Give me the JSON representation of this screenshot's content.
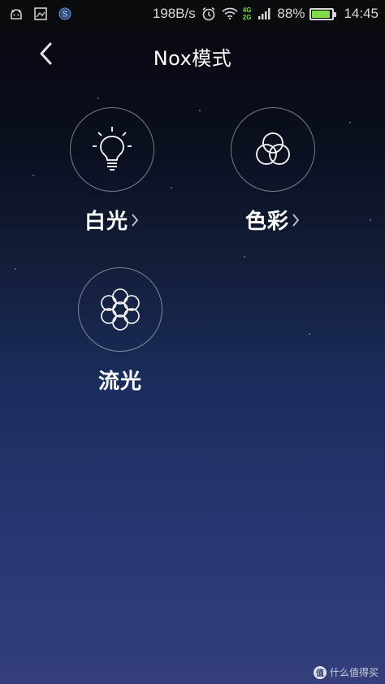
{
  "status_bar": {
    "net_speed": "198B/s",
    "network_tags": [
      "4G",
      "2G"
    ],
    "battery_percent": "88%",
    "battery_level": 0.88,
    "time": "14:45",
    "icons": [
      "android-icon",
      "image-icon",
      "app-s-icon",
      "alarm-icon",
      "wifi-icon",
      "signal-icon",
      "battery-charging-icon"
    ]
  },
  "header": {
    "title": "Nox模式",
    "back_icon": "back-chevron-icon"
  },
  "modes": [
    {
      "label": "白光",
      "icon": "lightbulb-icon",
      "has_arrow": true
    },
    {
      "label": "色彩",
      "icon": "color-circles-icon",
      "has_arrow": true
    },
    {
      "label": "流光",
      "icon": "flow-light-icon",
      "has_arrow": false
    }
  ],
  "watermark": {
    "badge": "值",
    "text": "什么值得买"
  },
  "colors": {
    "accent_green": "#7ddc48",
    "background_top": "#07080c",
    "background_bottom": "#343f7c"
  }
}
